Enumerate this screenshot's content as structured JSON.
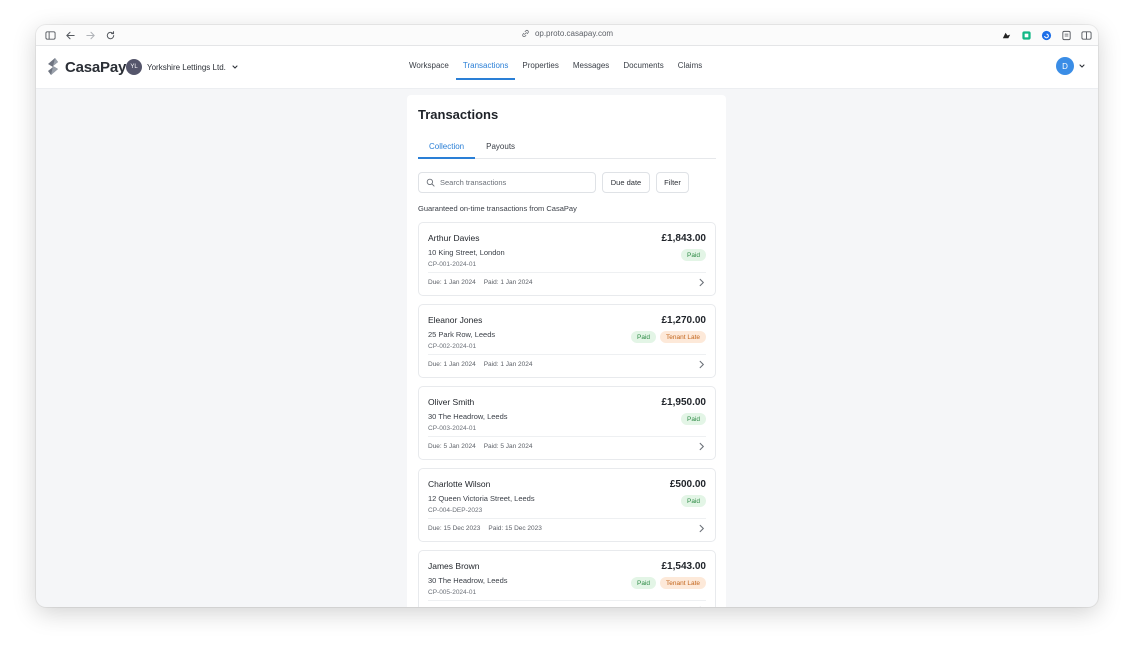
{
  "browser": {
    "url": "op.proto.casapay.com"
  },
  "app": {
    "brand": "CasaPay",
    "org_initials": "YL",
    "org_name": "Yorkshire Lettings Ltd.",
    "user_initial": "D",
    "accent_color": "#2a7fd6",
    "nav": [
      "Workspace",
      "Transactions",
      "Properties",
      "Messages",
      "Documents",
      "Claims"
    ],
    "nav_active": "Transactions"
  },
  "page": {
    "title": "Transactions",
    "tabs": [
      "Collection",
      "Payouts"
    ],
    "tab_active": "Collection",
    "search_placeholder": "Search transactions",
    "due_date_label": "Due date",
    "filter_label": "Filter",
    "subtitle": "Guaranteed on-time transactions from CasaPay"
  },
  "transactions": [
    {
      "name": "Arthur Davies",
      "address": "10 King Street, London",
      "ref": "CP-001-2024-01",
      "amount": "£1,843.00",
      "badges": [
        "Paid"
      ],
      "due": "Due: 1 Jan 2024",
      "paid": "Paid: 1 Jan 2024"
    },
    {
      "name": "Eleanor Jones",
      "address": "25 Park Row, Leeds",
      "ref": "CP-002-2024-01",
      "amount": "£1,270.00",
      "badges": [
        "Paid",
        "Tenant Late"
      ],
      "due": "Due: 1 Jan 2024",
      "paid": "Paid: 1 Jan 2024"
    },
    {
      "name": "Oliver Smith",
      "address": "30 The Headrow, Leeds",
      "ref": "CP-003-2024-01",
      "amount": "£1,950.00",
      "badges": [
        "Paid"
      ],
      "due": "Due: 5 Jan 2024",
      "paid": "Paid: 5 Jan 2024"
    },
    {
      "name": "Charlotte Wilson",
      "address": "12 Queen Victoria Street, Leeds",
      "ref": "CP-004-DEP-2023",
      "amount": "£500.00",
      "badges": [
        "Paid"
      ],
      "due": "Due: 15 Dec 2023",
      "paid": "Paid: 15 Dec 2023"
    },
    {
      "name": "James Brown",
      "address": "30 The Headrow, Leeds",
      "ref": "CP-005-2024-01",
      "amount": "£1,543.00",
      "badges": [
        "Paid",
        "Tenant Late"
      ],
      "due": "",
      "paid": ""
    }
  ]
}
